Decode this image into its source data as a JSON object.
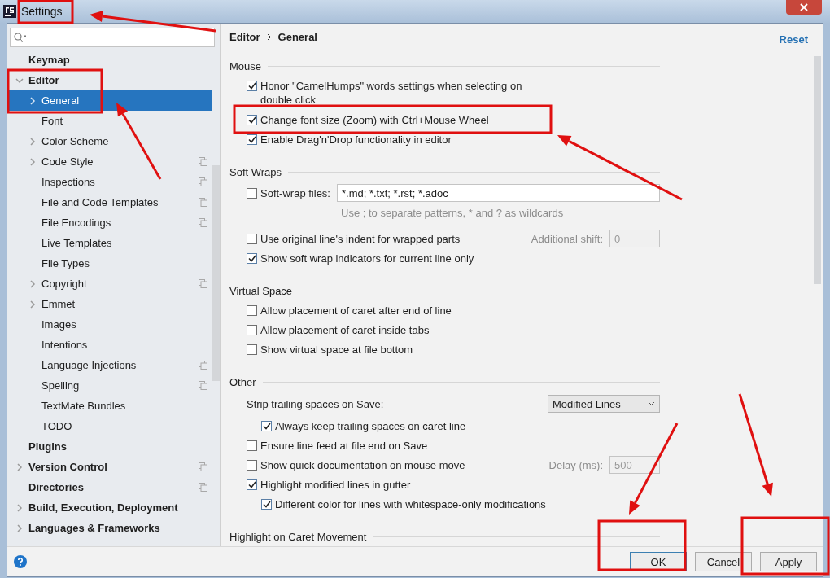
{
  "window": {
    "title": "Settings"
  },
  "sidebar": {
    "items": [
      {
        "label": "Keymap",
        "selected": false,
        "per_project": false
      },
      {
        "label": "Editor",
        "selected": false,
        "per_project": false,
        "expanded": true,
        "children": [
          {
            "label": "General",
            "selected": true,
            "per_project": false,
            "expanded": false
          },
          {
            "label": "Font",
            "selected": false,
            "per_project": false
          },
          {
            "label": "Color Scheme",
            "selected": false,
            "per_project": false,
            "expanded": false
          },
          {
            "label": "Code Style",
            "selected": false,
            "per_project": true,
            "expanded": false
          },
          {
            "label": "Inspections",
            "selected": false,
            "per_project": true
          },
          {
            "label": "File and Code Templates",
            "selected": false,
            "per_project": true
          },
          {
            "label": "File Encodings",
            "selected": false,
            "per_project": true
          },
          {
            "label": "Live Templates",
            "selected": false,
            "per_project": false
          },
          {
            "label": "File Types",
            "selected": false,
            "per_project": false
          },
          {
            "label": "Copyright",
            "selected": false,
            "per_project": true,
            "expanded": false
          },
          {
            "label": "Emmet",
            "selected": false,
            "per_project": false,
            "expanded": false
          },
          {
            "label": "Images",
            "selected": false,
            "per_project": false
          },
          {
            "label": "Intentions",
            "selected": false,
            "per_project": false
          },
          {
            "label": "Language Injections",
            "selected": false,
            "per_project": true
          },
          {
            "label": "Spelling",
            "selected": false,
            "per_project": true
          },
          {
            "label": "TextMate Bundles",
            "selected": false,
            "per_project": false
          },
          {
            "label": "TODO",
            "selected": false,
            "per_project": false
          }
        ]
      },
      {
        "label": "Plugins",
        "selected": false,
        "per_project": false
      },
      {
        "label": "Version Control",
        "selected": false,
        "per_project": true,
        "expanded": false
      },
      {
        "label": "Directories",
        "selected": false,
        "per_project": true
      },
      {
        "label": "Build, Execution, Deployment",
        "selected": false,
        "per_project": false,
        "expanded": false
      },
      {
        "label": "Languages & Frameworks",
        "selected": false,
        "per_project": false,
        "expanded": false
      }
    ]
  },
  "breadcrumb": [
    "Editor",
    "General"
  ],
  "reset_link": "Reset",
  "sections": [
    {
      "title": "Mouse",
      "items": [
        {
          "kind": "checkbox",
          "label": "Honor \"CamelHumps\" words settings when selecting on double click",
          "checked": true
        },
        {
          "kind": "checkbox",
          "label": "Change font size (Zoom) with Ctrl+Mouse Wheel",
          "checked": true
        },
        {
          "kind": "checkbox",
          "label": "Enable Drag'n'Drop functionality in editor",
          "checked": true
        }
      ]
    },
    {
      "title": "Soft Wraps",
      "items": [
        {
          "kind": "checkbox_field",
          "label": "Soft-wrap files:",
          "checked": false,
          "value": "*.md; *.txt; *.rst; *.adoc",
          "hint": "Use ; to separate patterns, * and ? as wildcards"
        },
        {
          "kind": "checkbox_aside",
          "label": "Use original line's indent for wrapped parts",
          "checked": false,
          "aside_label": "Additional shift:",
          "aside_value": "0",
          "aside_disabled": true
        },
        {
          "kind": "checkbox",
          "label": "Show soft wrap indicators for current line only",
          "checked": true
        }
      ]
    },
    {
      "title": "Virtual Space",
      "items": [
        {
          "kind": "checkbox",
          "label": "Allow placement of caret after end of line",
          "checked": false
        },
        {
          "kind": "checkbox",
          "label": "Allow placement of caret inside tabs",
          "checked": false
        },
        {
          "kind": "checkbox",
          "label": "Show virtual space at file bottom",
          "checked": false
        }
      ]
    },
    {
      "title": "Other",
      "items": [
        {
          "kind": "select",
          "label": "Strip trailing spaces on Save:",
          "value": "Modified Lines",
          "children": [
            {
              "kind": "checkbox",
              "label": "Always keep trailing spaces on caret line",
              "checked": true
            }
          ]
        },
        {
          "kind": "checkbox",
          "label": "Ensure line feed at file end on Save",
          "checked": false
        },
        {
          "kind": "checkbox_aside",
          "label": "Show quick documentation on mouse move",
          "checked": false,
          "aside_label": "Delay (ms):",
          "aside_value": "500",
          "aside_disabled": true
        },
        {
          "kind": "checkbox",
          "label": "Highlight modified lines in gutter",
          "checked": true,
          "children": [
            {
              "kind": "checkbox",
              "label": "Different color for lines with whitespace-only modifications",
              "checked": true
            }
          ]
        }
      ]
    },
    {
      "title": "Highlight on Caret Movement"
    }
  ],
  "buttons": [
    {
      "label": "OK",
      "default": true
    },
    {
      "label": "Cancel",
      "default": false
    },
    {
      "label": "Apply",
      "default": false
    }
  ]
}
